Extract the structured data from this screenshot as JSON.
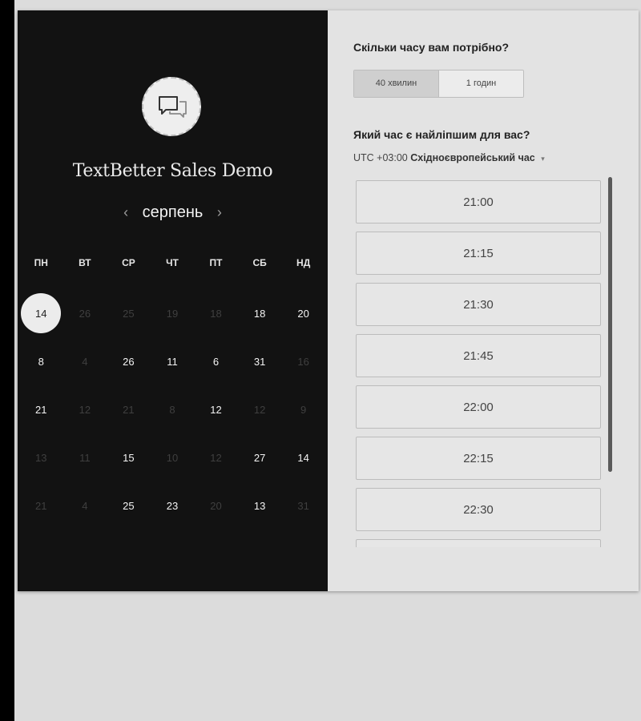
{
  "calendar": {
    "title": "TextBetter Sales Demo",
    "month": "серпень",
    "prev_icon": "‹",
    "next_icon": "›",
    "weekdays": [
      "ПН",
      "ВТ",
      "СР",
      "ЧТ",
      "ПТ",
      "СБ",
      "НД"
    ],
    "weeks": [
      [
        {
          "d": "14",
          "s": "sel"
        },
        {
          "d": "26",
          "s": "off"
        },
        {
          "d": "25",
          "s": "off"
        },
        {
          "d": "19",
          "s": "off"
        },
        {
          "d": "18",
          "s": "off"
        },
        {
          "d": "18",
          "s": "on"
        },
        {
          "d": "20",
          "s": "on"
        }
      ],
      [
        {
          "d": "8",
          "s": "on"
        },
        {
          "d": "4",
          "s": "off"
        },
        {
          "d": "26",
          "s": "on"
        },
        {
          "d": "11",
          "s": "on"
        },
        {
          "d": "6",
          "s": "on"
        },
        {
          "d": "31",
          "s": "on"
        },
        {
          "d": "16",
          "s": "off"
        }
      ],
      [
        {
          "d": "21",
          "s": "on"
        },
        {
          "d": "12",
          "s": "off"
        },
        {
          "d": "21",
          "s": "off"
        },
        {
          "d": "8",
          "s": "off"
        },
        {
          "d": "12",
          "s": "on"
        },
        {
          "d": "12",
          "s": "off"
        },
        {
          "d": "9",
          "s": "off"
        }
      ],
      [
        {
          "d": "13",
          "s": "off"
        },
        {
          "d": "11",
          "s": "off"
        },
        {
          "d": "15",
          "s": "on"
        },
        {
          "d": "10",
          "s": "off"
        },
        {
          "d": "12",
          "s": "off"
        },
        {
          "d": "27",
          "s": "on"
        },
        {
          "d": "14",
          "s": "on"
        }
      ],
      [
        {
          "d": "21",
          "s": "off"
        },
        {
          "d": "4",
          "s": "off"
        },
        {
          "d": "25",
          "s": "on"
        },
        {
          "d": "23",
          "s": "on"
        },
        {
          "d": "20",
          "s": "off"
        },
        {
          "d": "13",
          "s": "on"
        },
        {
          "d": "31",
          "s": "off"
        }
      ]
    ]
  },
  "booking": {
    "duration_question": "Скільки часу вам потрібно?",
    "durations": [
      "40 хвилин",
      "1 годин"
    ],
    "selected_duration": "40 хвилин",
    "time_question": "Який час є найліпшим для вас?",
    "timezone_offset": "UTC +03:00",
    "timezone_name": "Східноєвропейський час",
    "timezone_caret": "▾",
    "slots": [
      "21:00",
      "21:15",
      "21:30",
      "21:45",
      "22:00",
      "22:15",
      "22:30",
      ""
    ]
  },
  "icons": {
    "avatar": "chat-bubbles-icon"
  }
}
